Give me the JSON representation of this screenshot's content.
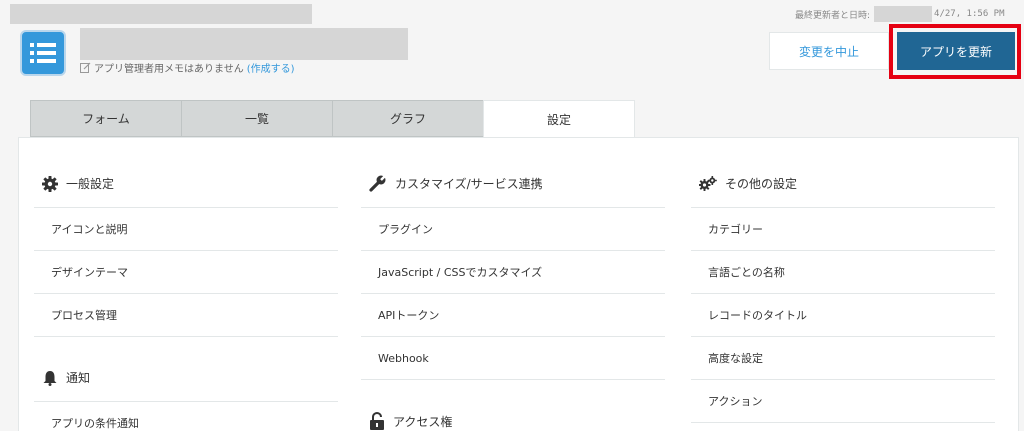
{
  "header": {
    "memo_text": "アプリ管理者用メモはありません",
    "memo_link": "(作成する)",
    "updated_label": "最終更新者と日時:",
    "updated_time": "4/27, 1:56 PM",
    "cancel_label": "変更を中止",
    "update_label": "アプリを更新"
  },
  "tabs": [
    {
      "label": "フォーム"
    },
    {
      "label": "一覧"
    },
    {
      "label": "グラフ"
    },
    {
      "label": "設定"
    }
  ],
  "settings": {
    "general": {
      "title": "一般設定",
      "items": [
        "アイコンと説明",
        "デザインテーマ",
        "プロセス管理"
      ]
    },
    "notification": {
      "title": "通知",
      "items": [
        "アプリの条件通知"
      ]
    },
    "customize": {
      "title": "カスタマイズ/サービス連携",
      "items": [
        "プラグイン",
        "JavaScript / CSSでカスタマイズ",
        "APIトークン",
        "Webhook"
      ]
    },
    "access": {
      "title": "アクセス権"
    },
    "other": {
      "title": "その他の設定",
      "items": [
        "カテゴリー",
        "言語ごとの名称",
        "レコードのタイトル",
        "高度な設定",
        "アクション"
      ]
    }
  }
}
